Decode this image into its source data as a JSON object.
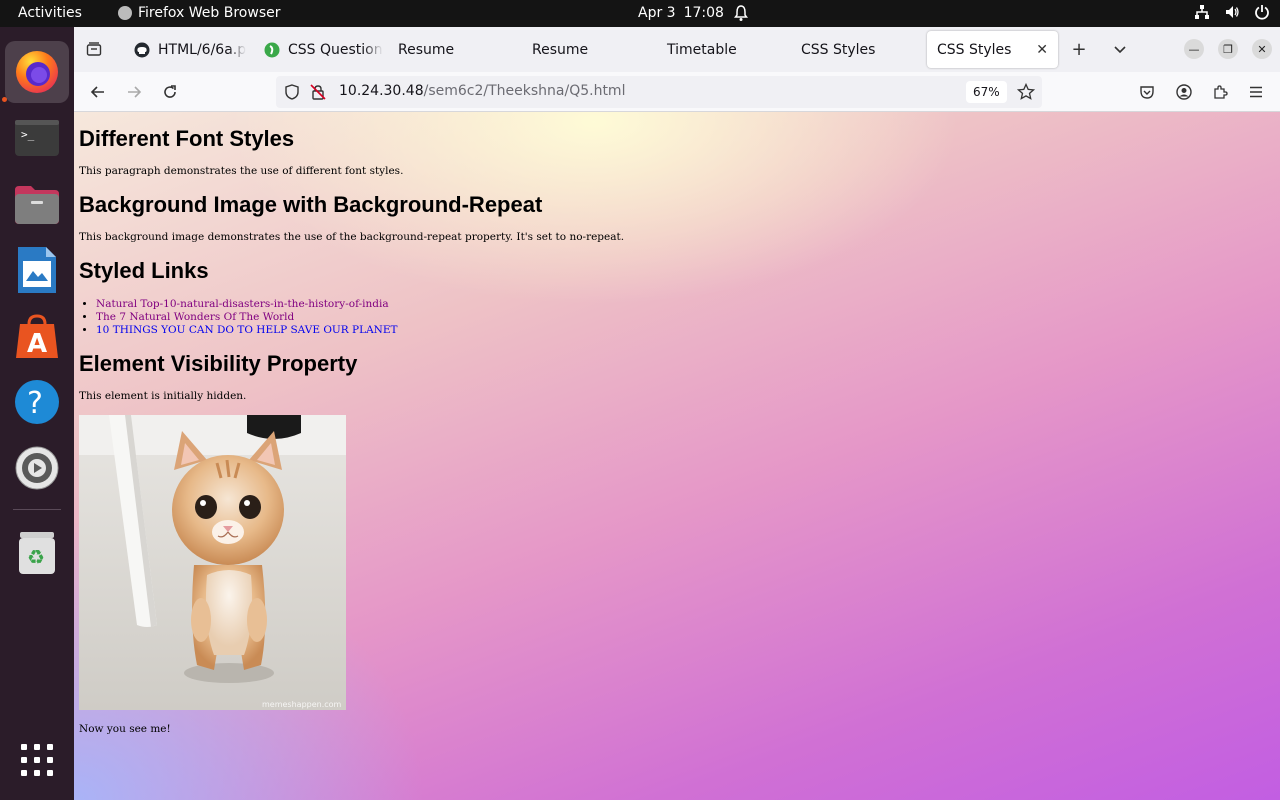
{
  "topbar": {
    "activities": "Activities",
    "app_name": "Firefox Web Browser",
    "date": "Apr 3",
    "time": "17:08"
  },
  "dock": {
    "items": [
      "firefox",
      "terminal",
      "files",
      "libreoffice-writer",
      "app-center",
      "help",
      "settings",
      "trash",
      "show-apps"
    ]
  },
  "browser": {
    "tabs": [
      {
        "label": "HTML/6/6a.p",
        "icon": "github-icon",
        "active": false
      },
      {
        "label": "CSS Question",
        "icon": "green-leaf-icon",
        "active": false
      },
      {
        "label": "Resume",
        "active": false
      },
      {
        "label": "Resume",
        "active": false
      },
      {
        "label": "Timetable",
        "active": false
      },
      {
        "label": "CSS Styles",
        "active": false
      },
      {
        "label": "CSS Styles",
        "active": true
      }
    ],
    "url_host": "10.24.30.48",
    "url_path": "/sem6c2/Theekshna/Q5.html",
    "zoom": "67%"
  },
  "page": {
    "h1": "Different Font Styles",
    "p1": "This paragraph demonstrates the use of different font styles.",
    "h2": "Background Image with Background-Repeat",
    "p2": "This background image demonstrates the use of the background-repeat property. It's set to no-repeat.",
    "h3": "Styled Links",
    "links": [
      {
        "text": "Natural Top-10-natural-disasters-in-the-history-of-india",
        "state": "visited"
      },
      {
        "text": "The 7 Natural Wonders Of The World",
        "state": "visited"
      },
      {
        "text": "10 THINGS YOU CAN DO TO HELP SAVE OUR PLANET",
        "state": "unvisited"
      }
    ],
    "h4": "Element Visibility Property",
    "p3": "This element is initially hidden.",
    "image_watermark": "memeshappen.com",
    "p4": "Now you see me!"
  },
  "colors": {
    "visited_link": "#800080",
    "unvisited_link": "#0000ee",
    "ubuntu_orange": "#e95420"
  }
}
